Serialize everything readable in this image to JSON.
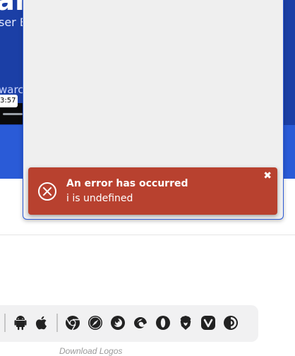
{
  "hero": {
    "title": "al te",
    "subtitle": "ser E:",
    "subtitle2": "warc"
  },
  "video": {
    "time": "3:57"
  },
  "error": {
    "title": "An error has occurred",
    "message": "i is undefined",
    "close_symbol": "✖",
    "color": "#b8412f"
  },
  "logos": {
    "icons": [
      "android-icon",
      "apple-icon",
      "chrome-icon",
      "safari-icon",
      "firefox-icon",
      "edge-icon",
      "opera-icon",
      "brave-icon",
      "vivaldi-icon",
      "tor-icon"
    ]
  },
  "footer": {
    "download_logos": "Download Logos"
  }
}
